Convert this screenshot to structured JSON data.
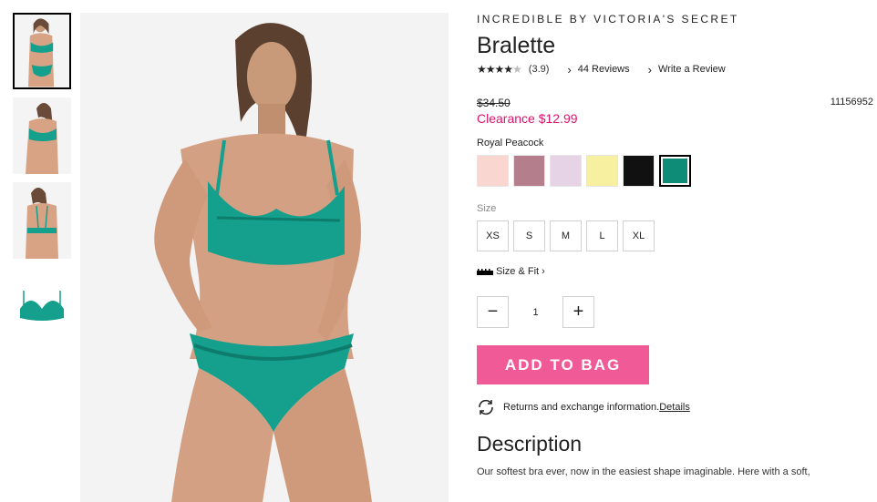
{
  "thumbnails": [
    {
      "name": "front-view",
      "active": true
    },
    {
      "name": "side-view",
      "active": false
    },
    {
      "name": "back-view",
      "active": false
    },
    {
      "name": "product-only",
      "active": false
    }
  ],
  "product": {
    "brand": "INCREDIBLE BY VICTORIA'S SECRET",
    "title": "Bralette",
    "stars_filled": "★★★★",
    "stars_empty": "★",
    "rating": "(3.9)",
    "reviews_link": "44 Reviews",
    "write_review_link": "Write a Review",
    "original_price": "$34.50",
    "sale_price": "Clearance $12.99",
    "sku": "11156952",
    "color_name": "Royal Peacock",
    "size_label": "Size",
    "size_fit_label": "Size & Fit",
    "quantity": "1",
    "add_to_bag": "ADD TO BAG",
    "returns_text": "Returns and exchange information.",
    "returns_link": "Details",
    "description_title": "Description",
    "description_text": "Our softest bra ever, now in the easiest shape imaginable. Here with a soft,"
  },
  "colors": [
    {
      "name": "pink",
      "hex": "#f9d6cf"
    },
    {
      "name": "mauve",
      "hex": "#b57e8c"
    },
    {
      "name": "lilac",
      "hex": "#e6d4e6"
    },
    {
      "name": "yellow",
      "hex": "#f7f0a1"
    },
    {
      "name": "black",
      "hex": "#111111"
    },
    {
      "name": "royal-peacock",
      "hex": "#0e8c77"
    }
  ],
  "sizes": [
    "XS",
    "S",
    "M",
    "L",
    "XL"
  ],
  "colors_theme": {
    "accent_pink": "#ef5a97",
    "sale_red": "#e0126c",
    "garment_teal": "#14a08c"
  }
}
